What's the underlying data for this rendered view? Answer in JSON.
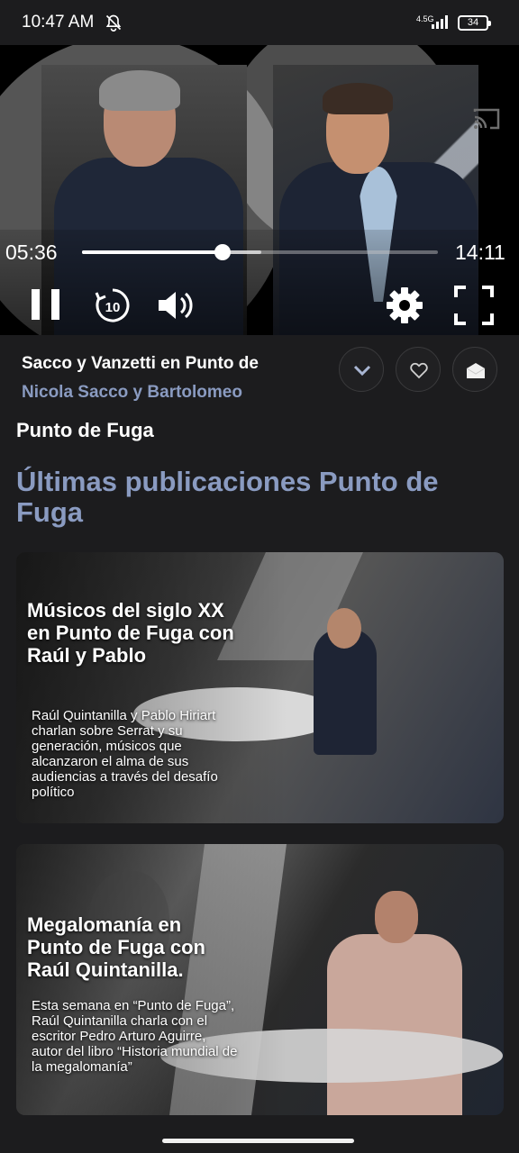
{
  "status_bar": {
    "time": "10:47 AM",
    "network": "4.5G",
    "battery": "34"
  },
  "player": {
    "current_time": "05:36",
    "total_time": "14:11",
    "progress": 0.395,
    "buffered": 0.505
  },
  "episode": {
    "title": "Sacco y Vanzetti en Punto de",
    "subtitle": "Nicola Sacco y Bartolomeo"
  },
  "program_name": "Punto de Fuga",
  "section_title": "Últimas publicaciones Punto de Fuga",
  "cards": [
    {
      "title": "Músicos del siglo XX en Punto de Fuga con Raúl y Pablo",
      "description": "Raúl Quintanilla y Pablo Hiriart charlan sobre Serrat y su generación, músicos que alcanzaron el alma de sus audiencias a través del desafío político"
    },
    {
      "title": "Megalomanía en Punto de Fuga con Raúl Quintanilla.",
      "description": "Esta semana en “Punto de Fuga”, Raúl Quintanilla charla con el escritor Pedro Arturo Aguirre, autor del libro “Historia mundial de la megalomanía”"
    }
  ],
  "icons": {
    "accent": "#8a9bc1"
  }
}
